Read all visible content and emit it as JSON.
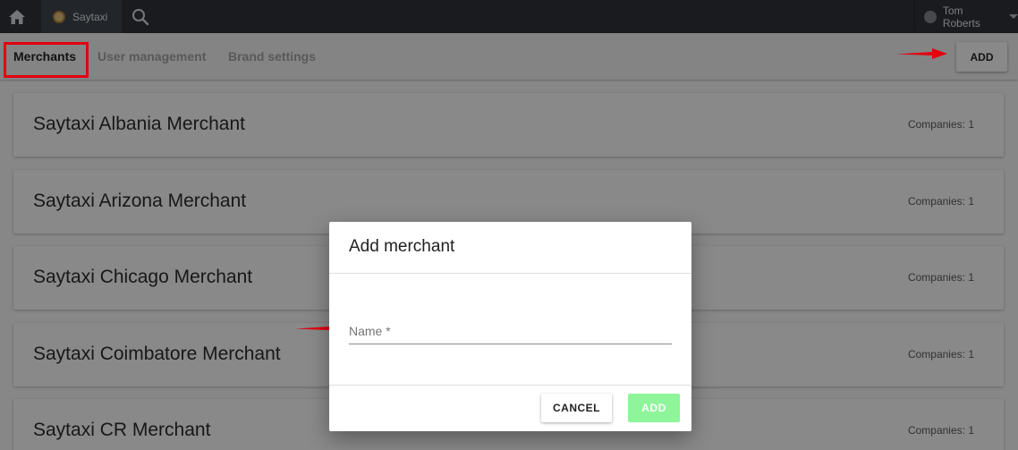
{
  "topbar": {
    "home_icon": "home-icon",
    "app_tab_label": "Saytaxi",
    "search_icon": "search-icon",
    "user_name": "Tom Roberts"
  },
  "subnav": {
    "tabs": [
      {
        "label": "Merchants",
        "active": true
      },
      {
        "label": "User management",
        "active": false
      },
      {
        "label": "Brand settings",
        "active": false
      }
    ],
    "add_label": "ADD"
  },
  "merchants": [
    {
      "name": "Saytaxi Albania Merchant",
      "companies": "Companies: 1"
    },
    {
      "name": "Saytaxi Arizona Merchant",
      "companies": "Companies: 1"
    },
    {
      "name": "Saytaxi Chicago Merchant",
      "companies": "Companies: 1"
    },
    {
      "name": "Saytaxi Coimbatore Merchant",
      "companies": "Companies: 1"
    },
    {
      "name": "Saytaxi CR Merchant",
      "companies": "Companies: 1"
    }
  ],
  "dialog": {
    "title": "Add merchant",
    "name_label": "Name *",
    "name_value": "",
    "cancel_label": "CANCEL",
    "add_label": "ADD"
  },
  "colors": {
    "topbar": "#2b2f36",
    "highlight": "#e3000f",
    "add_button_disabled": "#8ff59a"
  }
}
